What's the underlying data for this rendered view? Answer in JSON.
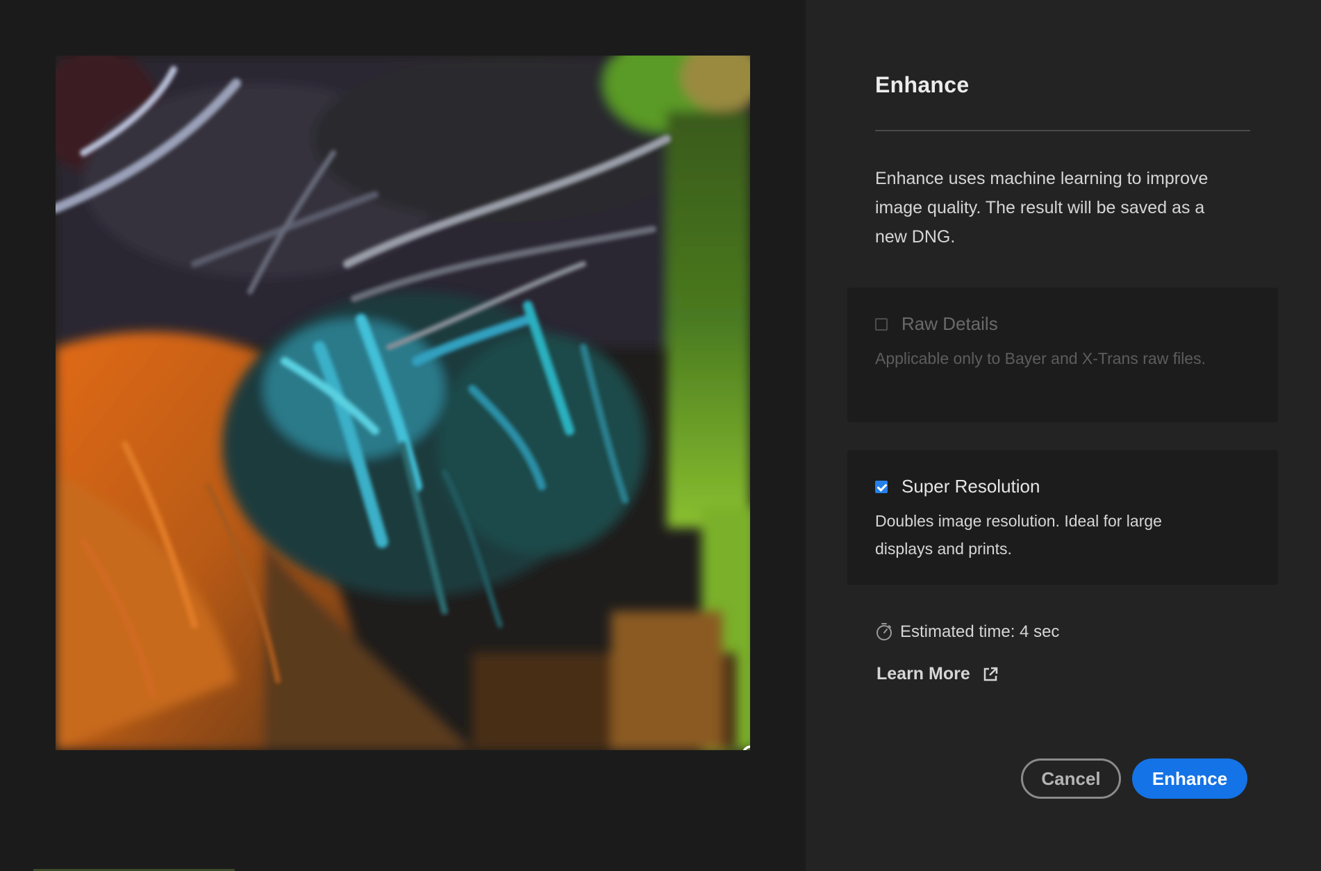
{
  "dialog": {
    "title": "Enhance",
    "description": "Enhance uses machine learning to improve image quality. The result will be saved as a new DNG."
  },
  "options": {
    "raw_details": {
      "label": "Raw Details",
      "description": "Applicable only to Bayer and X-Trans raw files.",
      "checked": false,
      "enabled": false
    },
    "super_resolution": {
      "label": "Super Resolution",
      "description": "Doubles image resolution. Ideal for large displays and prints.",
      "checked": true,
      "enabled": true
    }
  },
  "estimate": {
    "text": "Estimated time: 4 sec",
    "icon": "timer-icon"
  },
  "learn_more": {
    "label": "Learn More",
    "icon": "external-link-icon"
  },
  "buttons": {
    "cancel": "Cancel",
    "enhance": "Enhance"
  },
  "preview": {
    "icon": "zoom-out-icon",
    "subject": "bird-plumage-closeup"
  },
  "colors": {
    "accent": "#1473e6",
    "panel": "#232323",
    "card": "#1c1c1c",
    "background": "#1b1b1b"
  }
}
